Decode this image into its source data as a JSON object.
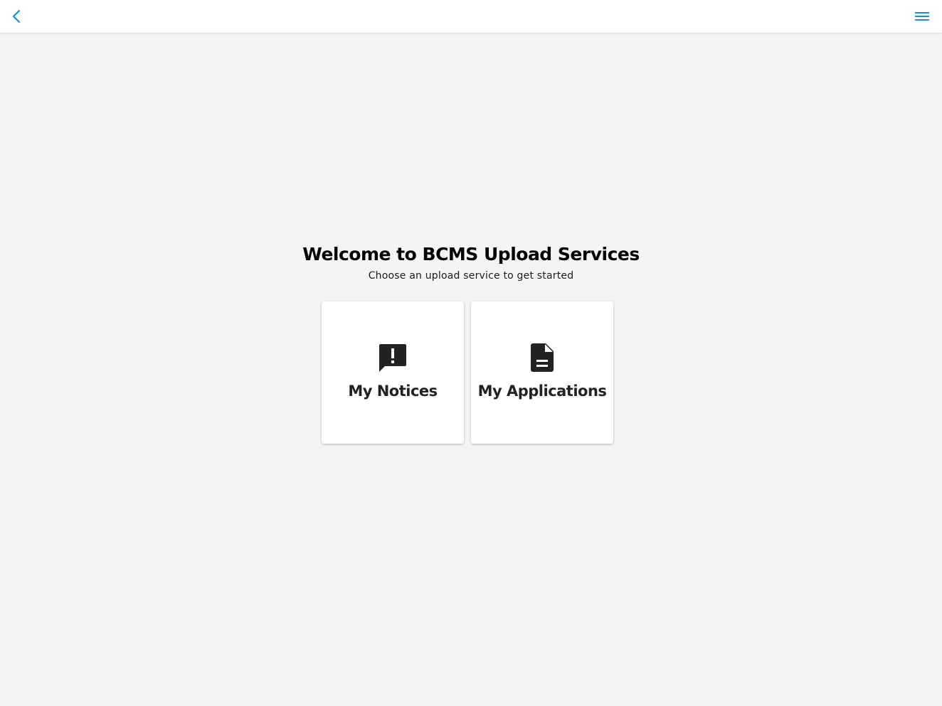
{
  "header": {
    "back_icon": "chevron-left-icon",
    "menu_icon": "hamburger-menu-icon",
    "accent_color": "#1a8fd6"
  },
  "welcome": {
    "title": "Welcome to BCMS Upload Services",
    "subtitle": "Choose an upload service to get started"
  },
  "cards": [
    {
      "label": "My Notices",
      "icon": "announcement-icon"
    },
    {
      "label": "My Applications",
      "icon": "document-icon"
    }
  ]
}
